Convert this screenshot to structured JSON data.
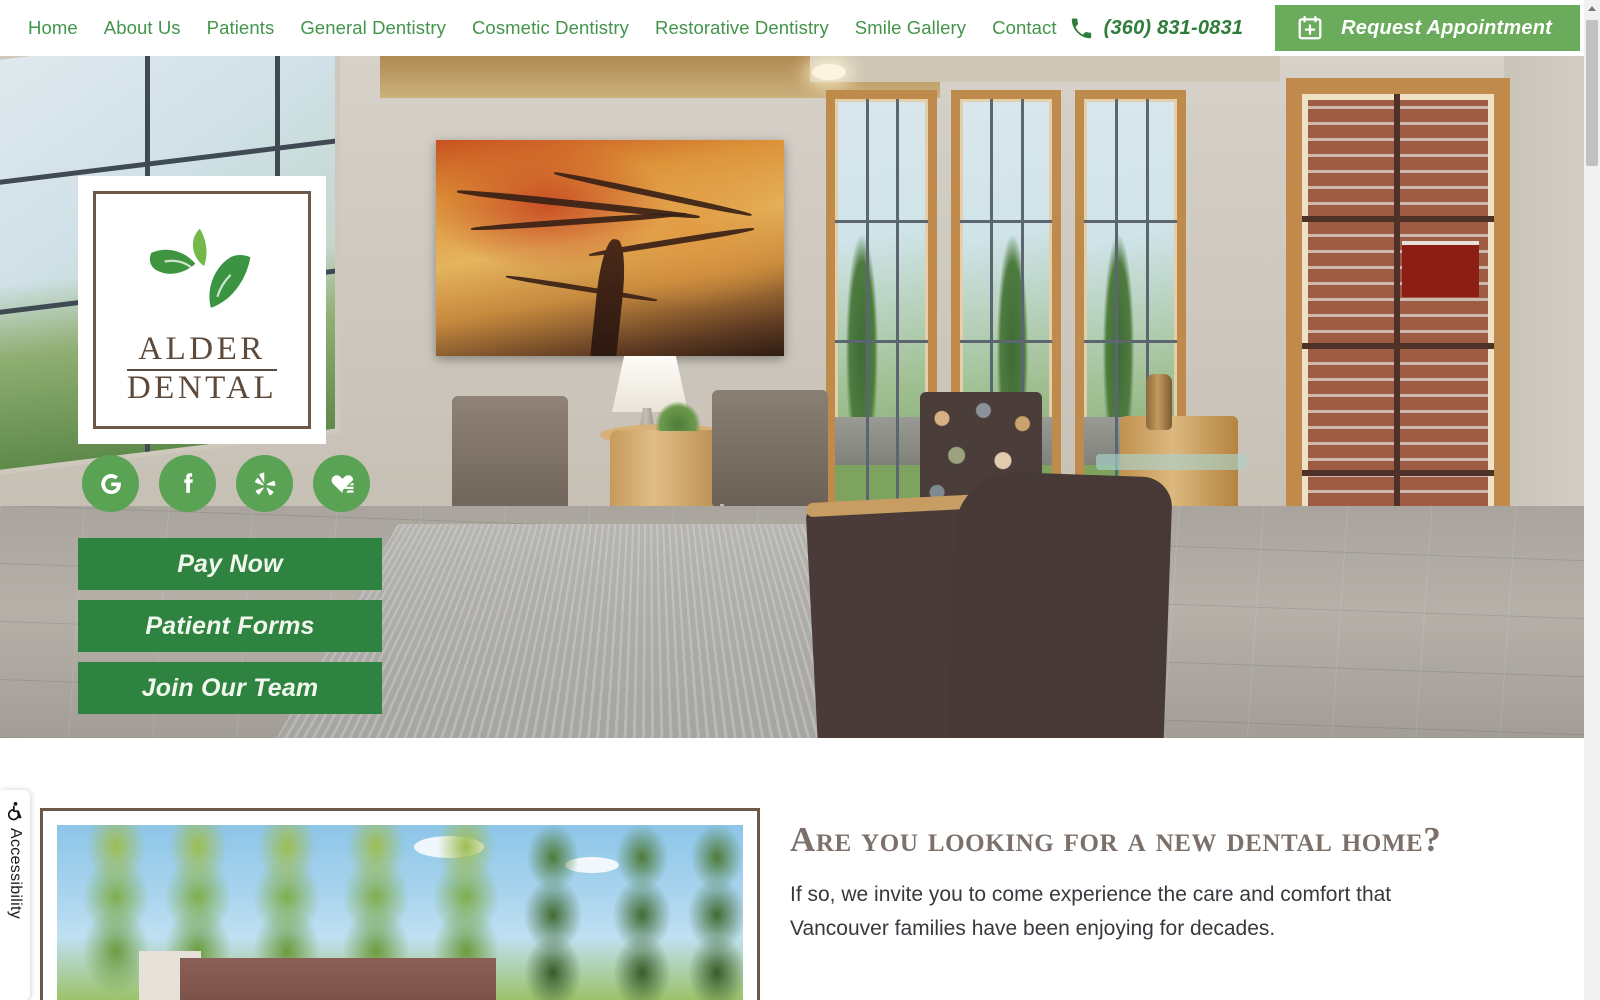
{
  "header": {
    "nav": [
      {
        "label": "Home"
      },
      {
        "label": "About Us"
      },
      {
        "label": "Patients"
      },
      {
        "label": "General Dentistry"
      },
      {
        "label": "Cosmetic Dentistry"
      },
      {
        "label": "Restorative Dentistry"
      },
      {
        "label": "Smile Gallery"
      },
      {
        "label": "Contact"
      }
    ],
    "phone": {
      "icon": "phone-icon",
      "number": "(360) 831-0831"
    },
    "appointment_button": {
      "icon": "calendar-plus-icon",
      "label": "Request Appointment"
    }
  },
  "hero": {
    "logo": {
      "line1": "ALDER",
      "line2": "DENTAL",
      "icon": "leaves-icon"
    },
    "social": [
      {
        "name": "google-icon",
        "label": "G"
      },
      {
        "name": "facebook-icon",
        "label": "f"
      },
      {
        "name": "yelp-icon",
        "label": ""
      },
      {
        "name": "healthgrades-icon",
        "label": ""
      }
    ],
    "cta": [
      {
        "label": "Pay Now"
      },
      {
        "label": "Patient Forms"
      },
      {
        "label": "Join Our Team"
      }
    ]
  },
  "content": {
    "heading": "Are you looking for a new dental home?",
    "paragraph": "If so, we invite you to come experience the care and comfort that Vancouver families have been enjoying for decades."
  },
  "accessibility": {
    "label": "Accessibility",
    "icon": "wheelchair-icon"
  },
  "colors": {
    "brand_green": "#2f8340",
    "nav_green": "#42954b",
    "button_green_light": "#6aab5c",
    "social_green": "#5aa254",
    "logo_brown": "#5d4a3a",
    "heading_brown": "#7b716a"
  }
}
